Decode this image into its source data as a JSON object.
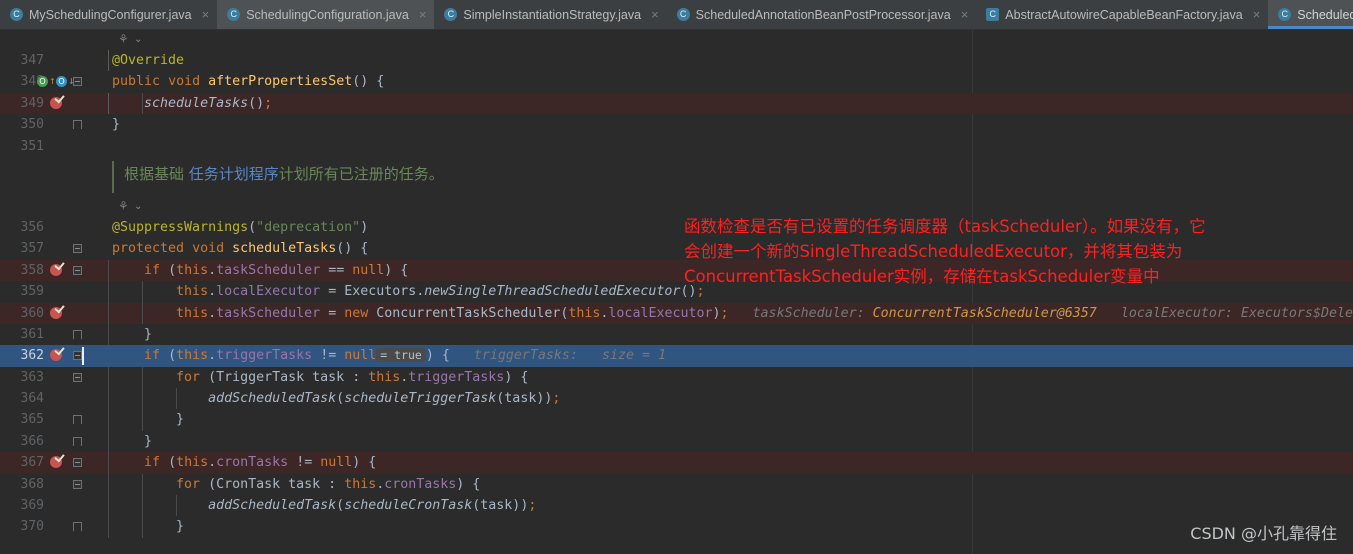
{
  "window": {
    "app": "IntelliJ IDEA editor",
    "colors": {
      "editor_background": "#2b2b2b",
      "tabbar_background": "#3c3f41",
      "active_tab_background": "#4e5254",
      "active_tab_underline": "#4a88c7",
      "breakpoint_line_background": "#3d2626",
      "execution_line_background": "#2f5580",
      "annotation_red": "#ff2020",
      "gutter_text": "#606366"
    }
  },
  "tabs": [
    {
      "label": "MySchedulingConfigurer.java",
      "icon": "java-class-icon",
      "active": false,
      "closable": true
    },
    {
      "label": "SchedulingConfiguration.java",
      "icon": "java-class-icon",
      "active": false,
      "closable": true
    },
    {
      "label": "SimpleInstantiationStrategy.java",
      "icon": "java-class-icon",
      "active": false,
      "closable": true
    },
    {
      "label": "ScheduledAnnotationBeanPostProcessor.java",
      "icon": "java-class-icon",
      "active": false,
      "closable": true
    },
    {
      "label": "AbstractAutowireCapableBeanFactory.java",
      "icon": "java-class-readonly-icon",
      "active": false,
      "closable": true
    },
    {
      "label": "ScheduledTaskRegistrar.java",
      "icon": "java-class-icon",
      "active": true,
      "closable": false
    }
  ],
  "tab_close_glyph": "×",
  "editor": {
    "gutter_icons": {
      "spring_bean_glyph": "⚘",
      "chevron_down_glyph": "⌄",
      "override_implements_glyph": "O",
      "override_implemented_glyph": "O",
      "arrow_up_glyph": "↑",
      "arrow_down_glyph": "↓"
    },
    "lines": [
      {
        "num": "347",
        "text": "@Override"
      },
      {
        "num": "348",
        "text": "public void afterPropertiesSet() {"
      },
      {
        "num": "349",
        "text": "    scheduleTasks();"
      },
      {
        "num": "350",
        "text": "}"
      },
      {
        "num": "351",
        "text": ""
      },
      {
        "num": "356",
        "text": "@SuppressWarnings(\"deprecation\")"
      },
      {
        "num": "357",
        "text": "protected void scheduleTasks() {"
      },
      {
        "num": "358",
        "text": "    if (this.taskScheduler == null) {"
      },
      {
        "num": "359",
        "text": "        this.localExecutor = Executors.newSingleThreadScheduledExecutor();"
      },
      {
        "num": "360",
        "text": "        this.taskScheduler = new ConcurrentTaskScheduler(this.localExecutor);"
      },
      {
        "num": "361",
        "text": "    }"
      },
      {
        "num": "362",
        "text": "    if (this.triggerTasks != null) {"
      },
      {
        "num": "363",
        "text": "        for (TriggerTask task : this.triggerTasks) {"
      },
      {
        "num": "364",
        "text": "            addScheduledTask(scheduleTriggerTask(task));"
      },
      {
        "num": "365",
        "text": "        }"
      },
      {
        "num": "366",
        "text": "    }"
      },
      {
        "num": "367",
        "text": "    if (this.cronTasks != null) {"
      },
      {
        "num": "368",
        "text": "        for (CronTask task : this.cronTasks) {"
      },
      {
        "num": "369",
        "text": "            addScheduledTask(scheduleCronTask(task));"
      },
      {
        "num": "370",
        "text": "        }"
      }
    ],
    "doc_comment": {
      "part_green_1": "根据基础 ",
      "part_blue": "任务计划程序",
      "part_green_2": "计划所有已注册的任务。"
    },
    "inline_debug_hints": {
      "line360_name": "taskScheduler:",
      "line360_value": "ConcurrentTaskScheduler@6357",
      "line360_name2": "localExecutor:",
      "line360_value2": "Executors$DelegatedSchedul",
      "line362_badge": "= true",
      "line362_name": "triggerTasks:",
      "line362_value": "size = 1"
    }
  },
  "annotation": {
    "line1": "函数检查是否有已设置的任务调度器（taskScheduler）。如果没有，它",
    "line2": "会创建一个新的SingleThreadScheduledExecutor，并将其包装为",
    "line3": "ConcurrentTaskScheduler实例，存储在taskScheduler变量中"
  },
  "watermark": {
    "text": "CSDN @小孔靠得住"
  }
}
